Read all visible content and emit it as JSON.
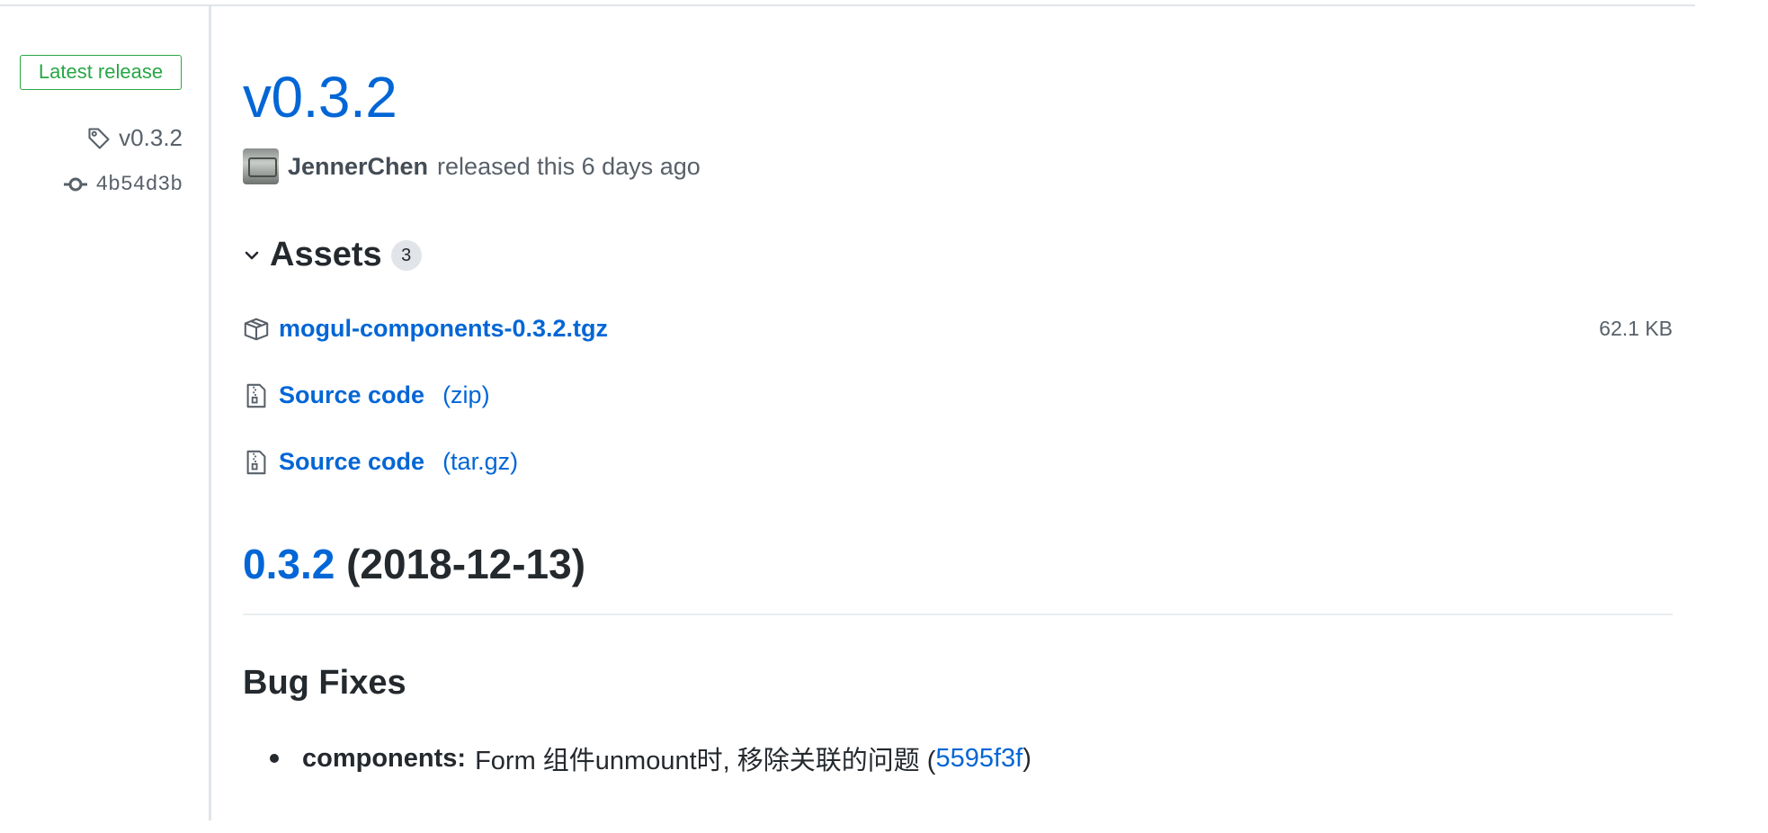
{
  "sidebar": {
    "badge": "Latest release",
    "tag": "v0.3.2",
    "commit": "4b54d3b"
  },
  "release": {
    "title": "v0.3.2",
    "author": "JennerChen",
    "meta_text": "released this 6 days ago"
  },
  "assets": {
    "title": "Assets",
    "count": "3",
    "items": [
      {
        "name": "mogul-components-0.3.2.tgz",
        "suffix": "",
        "size": "62.1 KB",
        "icon": "package-icon"
      },
      {
        "name": "Source code",
        "suffix": "(zip)",
        "size": "",
        "icon": "file-zip-icon"
      },
      {
        "name": "Source code",
        "suffix": "(tar.gz)",
        "size": "",
        "icon": "file-zip-icon"
      }
    ]
  },
  "notes": {
    "version_link": "0.3.2",
    "version_date": "(2018-12-13)",
    "section_title": "Bug Fixes",
    "items": [
      {
        "scope": "components:",
        "text": "Form 组件unmount时, 移除关联的问题 (",
        "commit": "5595f3f",
        "close": ")"
      }
    ]
  },
  "colors": {
    "link": "#0366d6",
    "badge_green": "#28a745",
    "text": "#24292e",
    "muted": "#586069"
  }
}
